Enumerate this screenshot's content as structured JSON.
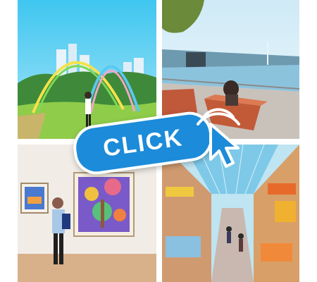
{
  "cta": {
    "label": "CLICK"
  },
  "tiles": [
    {
      "name": "rainbow-arch-park-photo"
    },
    {
      "name": "lakeside-bench-photo"
    },
    {
      "name": "art-gallery-photo"
    },
    {
      "name": "market-street-photo"
    }
  ],
  "colors": {
    "accent": "#1c8bd9",
    "outline": "#ffffff"
  }
}
